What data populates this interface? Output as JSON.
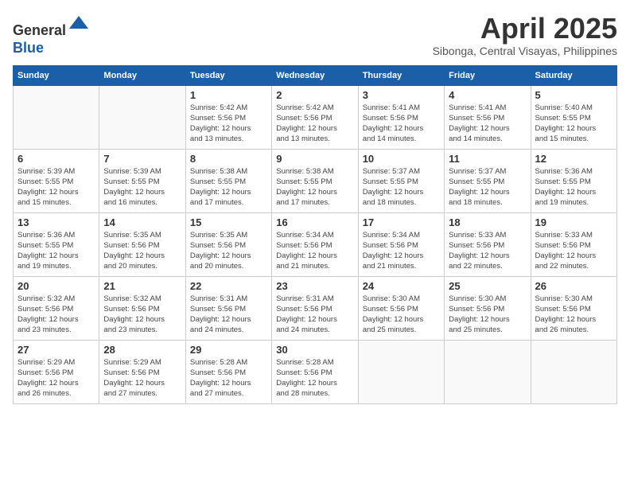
{
  "header": {
    "logo_line1": "General",
    "logo_line2": "Blue",
    "month_title": "April 2025",
    "location": "Sibonga, Central Visayas, Philippines"
  },
  "days_of_week": [
    "Sunday",
    "Monday",
    "Tuesday",
    "Wednesday",
    "Thursday",
    "Friday",
    "Saturday"
  ],
  "weeks": [
    [
      {
        "day": "",
        "content": ""
      },
      {
        "day": "",
        "content": ""
      },
      {
        "day": "1",
        "content": "Sunrise: 5:42 AM\nSunset: 5:56 PM\nDaylight: 12 hours\nand 13 minutes."
      },
      {
        "day": "2",
        "content": "Sunrise: 5:42 AM\nSunset: 5:56 PM\nDaylight: 12 hours\nand 13 minutes."
      },
      {
        "day": "3",
        "content": "Sunrise: 5:41 AM\nSunset: 5:56 PM\nDaylight: 12 hours\nand 14 minutes."
      },
      {
        "day": "4",
        "content": "Sunrise: 5:41 AM\nSunset: 5:56 PM\nDaylight: 12 hours\nand 14 minutes."
      },
      {
        "day": "5",
        "content": "Sunrise: 5:40 AM\nSunset: 5:55 PM\nDaylight: 12 hours\nand 15 minutes."
      }
    ],
    [
      {
        "day": "6",
        "content": "Sunrise: 5:39 AM\nSunset: 5:55 PM\nDaylight: 12 hours\nand 15 minutes."
      },
      {
        "day": "7",
        "content": "Sunrise: 5:39 AM\nSunset: 5:55 PM\nDaylight: 12 hours\nand 16 minutes."
      },
      {
        "day": "8",
        "content": "Sunrise: 5:38 AM\nSunset: 5:55 PM\nDaylight: 12 hours\nand 17 minutes."
      },
      {
        "day": "9",
        "content": "Sunrise: 5:38 AM\nSunset: 5:55 PM\nDaylight: 12 hours\nand 17 minutes."
      },
      {
        "day": "10",
        "content": "Sunrise: 5:37 AM\nSunset: 5:55 PM\nDaylight: 12 hours\nand 18 minutes."
      },
      {
        "day": "11",
        "content": "Sunrise: 5:37 AM\nSunset: 5:55 PM\nDaylight: 12 hours\nand 18 minutes."
      },
      {
        "day": "12",
        "content": "Sunrise: 5:36 AM\nSunset: 5:55 PM\nDaylight: 12 hours\nand 19 minutes."
      }
    ],
    [
      {
        "day": "13",
        "content": "Sunrise: 5:36 AM\nSunset: 5:55 PM\nDaylight: 12 hours\nand 19 minutes."
      },
      {
        "day": "14",
        "content": "Sunrise: 5:35 AM\nSunset: 5:56 PM\nDaylight: 12 hours\nand 20 minutes."
      },
      {
        "day": "15",
        "content": "Sunrise: 5:35 AM\nSunset: 5:56 PM\nDaylight: 12 hours\nand 20 minutes."
      },
      {
        "day": "16",
        "content": "Sunrise: 5:34 AM\nSunset: 5:56 PM\nDaylight: 12 hours\nand 21 minutes."
      },
      {
        "day": "17",
        "content": "Sunrise: 5:34 AM\nSunset: 5:56 PM\nDaylight: 12 hours\nand 21 minutes."
      },
      {
        "day": "18",
        "content": "Sunrise: 5:33 AM\nSunset: 5:56 PM\nDaylight: 12 hours\nand 22 minutes."
      },
      {
        "day": "19",
        "content": "Sunrise: 5:33 AM\nSunset: 5:56 PM\nDaylight: 12 hours\nand 22 minutes."
      }
    ],
    [
      {
        "day": "20",
        "content": "Sunrise: 5:32 AM\nSunset: 5:56 PM\nDaylight: 12 hours\nand 23 minutes."
      },
      {
        "day": "21",
        "content": "Sunrise: 5:32 AM\nSunset: 5:56 PM\nDaylight: 12 hours\nand 23 minutes."
      },
      {
        "day": "22",
        "content": "Sunrise: 5:31 AM\nSunset: 5:56 PM\nDaylight: 12 hours\nand 24 minutes."
      },
      {
        "day": "23",
        "content": "Sunrise: 5:31 AM\nSunset: 5:56 PM\nDaylight: 12 hours\nand 24 minutes."
      },
      {
        "day": "24",
        "content": "Sunrise: 5:30 AM\nSunset: 5:56 PM\nDaylight: 12 hours\nand 25 minutes."
      },
      {
        "day": "25",
        "content": "Sunrise: 5:30 AM\nSunset: 5:56 PM\nDaylight: 12 hours\nand 25 minutes."
      },
      {
        "day": "26",
        "content": "Sunrise: 5:30 AM\nSunset: 5:56 PM\nDaylight: 12 hours\nand 26 minutes."
      }
    ],
    [
      {
        "day": "27",
        "content": "Sunrise: 5:29 AM\nSunset: 5:56 PM\nDaylight: 12 hours\nand 26 minutes."
      },
      {
        "day": "28",
        "content": "Sunrise: 5:29 AM\nSunset: 5:56 PM\nDaylight: 12 hours\nand 27 minutes."
      },
      {
        "day": "29",
        "content": "Sunrise: 5:28 AM\nSunset: 5:56 PM\nDaylight: 12 hours\nand 27 minutes."
      },
      {
        "day": "30",
        "content": "Sunrise: 5:28 AM\nSunset: 5:56 PM\nDaylight: 12 hours\nand 28 minutes."
      },
      {
        "day": "",
        "content": ""
      },
      {
        "day": "",
        "content": ""
      },
      {
        "day": "",
        "content": ""
      }
    ]
  ]
}
